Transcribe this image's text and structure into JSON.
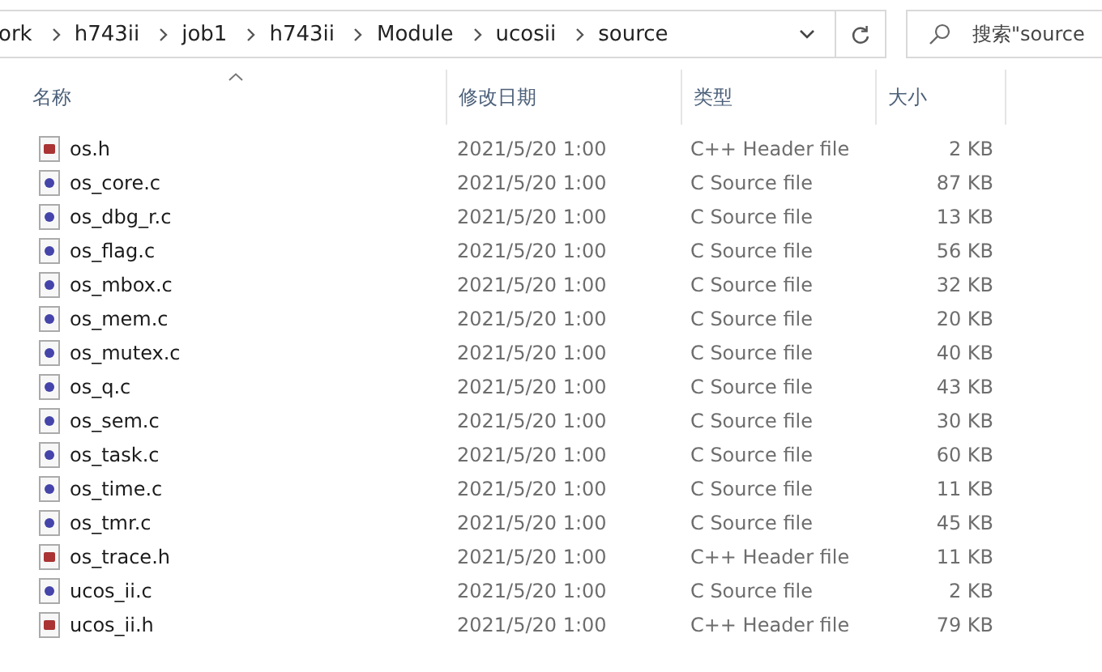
{
  "address_bar": {
    "crumbs": [
      "ork",
      "h743ii",
      "job1",
      "h743ii",
      "Module",
      "ucosii",
      "source"
    ]
  },
  "search": {
    "placeholder": "搜索\"source"
  },
  "columns": [
    {
      "label": "名称",
      "sorted": true
    },
    {
      "label": "修改日期",
      "sorted": false
    },
    {
      "label": "类型",
      "sorted": false
    },
    {
      "label": "大小",
      "sorted": false
    }
  ],
  "files": [
    {
      "kind": "header",
      "name": "os.h",
      "date": "2021/5/20 1:00",
      "type": "C++ Header file",
      "size": "2 KB"
    },
    {
      "kind": "source",
      "name": "os_core.c",
      "date": "2021/5/20 1:00",
      "type": "C Source file",
      "size": "87 KB"
    },
    {
      "kind": "source",
      "name": "os_dbg_r.c",
      "date": "2021/5/20 1:00",
      "type": "C Source file",
      "size": "13 KB"
    },
    {
      "kind": "source",
      "name": "os_flag.c",
      "date": "2021/5/20 1:00",
      "type": "C Source file",
      "size": "56 KB"
    },
    {
      "kind": "source",
      "name": "os_mbox.c",
      "date": "2021/5/20 1:00",
      "type": "C Source file",
      "size": "32 KB"
    },
    {
      "kind": "source",
      "name": "os_mem.c",
      "date": "2021/5/20 1:00",
      "type": "C Source file",
      "size": "20 KB"
    },
    {
      "kind": "source",
      "name": "os_mutex.c",
      "date": "2021/5/20 1:00",
      "type": "C Source file",
      "size": "40 KB"
    },
    {
      "kind": "source",
      "name": "os_q.c",
      "date": "2021/5/20 1:00",
      "type": "C Source file",
      "size": "43 KB"
    },
    {
      "kind": "source",
      "name": "os_sem.c",
      "date": "2021/5/20 1:00",
      "type": "C Source file",
      "size": "30 KB"
    },
    {
      "kind": "source",
      "name": "os_task.c",
      "date": "2021/5/20 1:00",
      "type": "C Source file",
      "size": "60 KB"
    },
    {
      "kind": "source",
      "name": "os_time.c",
      "date": "2021/5/20 1:00",
      "type": "C Source file",
      "size": "11 KB"
    },
    {
      "kind": "source",
      "name": "os_tmr.c",
      "date": "2021/5/20 1:00",
      "type": "C Source file",
      "size": "45 KB"
    },
    {
      "kind": "header",
      "name": "os_trace.h",
      "date": "2021/5/20 1:00",
      "type": "C++ Header file",
      "size": "11 KB"
    },
    {
      "kind": "source",
      "name": "ucos_ii.c",
      "date": "2021/5/20 1:00",
      "type": "C Source file",
      "size": "2 KB"
    },
    {
      "kind": "header",
      "name": "ucos_ii.h",
      "date": "2021/5/20 1:00",
      "type": "C++ Header file",
      "size": "79 KB"
    }
  ]
}
